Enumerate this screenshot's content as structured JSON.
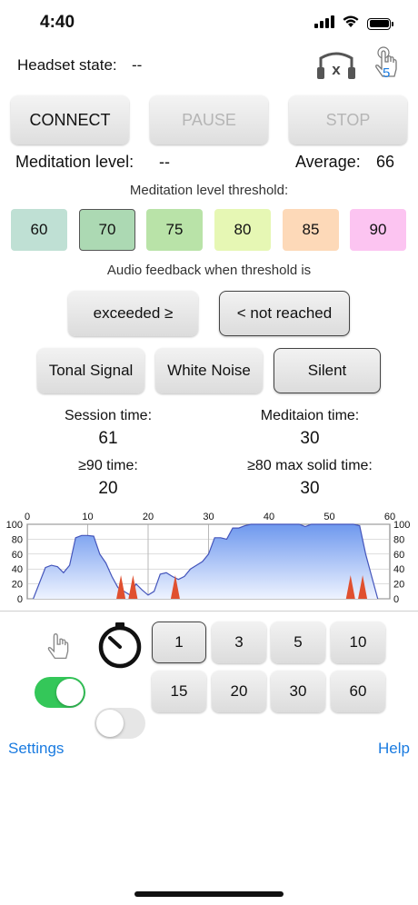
{
  "status_bar": {
    "time": "4:40"
  },
  "header": {
    "headset_label": "Headset state:",
    "headset_value": "--",
    "touch_badge": "5",
    "icons": [
      "headset-x-icon",
      "touch-hand-icon"
    ]
  },
  "controls": {
    "connect": "CONNECT",
    "pause": "PAUSE",
    "stop": "STOP"
  },
  "meditation": {
    "level_label": "Meditation level:",
    "level_value": "--",
    "average_label": "Average:",
    "average_value": "66"
  },
  "threshold": {
    "title": "Meditation level threshold:",
    "options": [
      {
        "label": "60",
        "color": "#bfe0d4"
      },
      {
        "label": "70",
        "color": "#acd9b3",
        "selected": true
      },
      {
        "label": "75",
        "color": "#b9e3a8"
      },
      {
        "label": "80",
        "color": "#e6f7b4"
      },
      {
        "label": "85",
        "color": "#fdd9b8"
      },
      {
        "label": "90",
        "color": "#fcc4f1"
      }
    ]
  },
  "audio": {
    "title": "Audio feedback when threshold is",
    "exceeded": "exceeded ≥",
    "not_reached": "< not reached",
    "tonal": "Tonal Signal",
    "white_noise": "White Noise",
    "silent": "Silent"
  },
  "stats": {
    "session_label": "Session time:",
    "session_value": "61",
    "meditation_label": "Meditaion time:",
    "meditation_value": "30",
    "ge90_label": "≥90 time:",
    "ge90_value": "20",
    "ge80_label": "≥80 max solid time:",
    "ge80_value": "30"
  },
  "chart_data": {
    "type": "area",
    "xlim": [
      0,
      60
    ],
    "ylim": [
      0,
      100
    ],
    "x_ticks": [
      "0",
      "10",
      "20",
      "30",
      "40",
      "50",
      "60"
    ],
    "y_ticks": [
      "0",
      "20",
      "40",
      "60",
      "80",
      "100"
    ],
    "grid": true,
    "fill_color": "#7ea6f0",
    "line_color": "#4455bb",
    "marker_color": "#e0502f",
    "x": [
      1,
      3,
      4,
      5,
      6,
      7,
      8,
      9,
      10,
      11,
      12,
      13,
      14,
      15,
      16,
      17,
      18,
      19,
      20,
      21,
      22,
      23,
      24,
      25,
      26,
      27,
      28,
      29,
      30,
      31,
      32,
      33,
      34,
      35,
      36,
      37,
      38,
      39,
      40,
      41,
      42,
      43,
      44,
      45,
      46,
      47,
      48,
      49,
      50,
      51,
      52,
      53,
      54,
      55,
      56,
      57,
      58
    ],
    "y": [
      0,
      42,
      45,
      43,
      35,
      45,
      82,
      85,
      85,
      84,
      60,
      48,
      30,
      15,
      10,
      5,
      20,
      12,
      5,
      10,
      33,
      35,
      30,
      26,
      30,
      40,
      45,
      50,
      60,
      82,
      82,
      80,
      95,
      95,
      98,
      100,
      100,
      100,
      100,
      100,
      100,
      100,
      100,
      100,
      97,
      100,
      100,
      100,
      100,
      100,
      100,
      100,
      100,
      98,
      60,
      30,
      0
    ],
    "markers_x": [
      15.5,
      17.5,
      24.5,
      53.5,
      55.5
    ]
  },
  "timer": {
    "durations": [
      "1",
      "3",
      "5",
      "10",
      "15",
      "20",
      "30",
      "60"
    ],
    "selected": "1",
    "icons": [
      "touch-hand-icon",
      "stopwatch-icon"
    ],
    "toggle_left_on": true,
    "toggle_right_on": false
  },
  "footer": {
    "settings": "Settings",
    "help": "Help"
  }
}
